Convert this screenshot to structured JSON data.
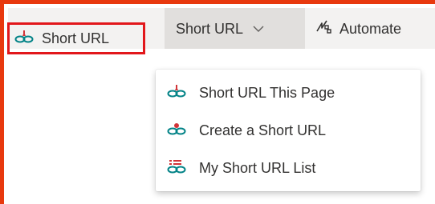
{
  "toolbar": {
    "short_url_button": {
      "label": "Short URL",
      "icon": "link-icon"
    },
    "short_url_dropdown": {
      "label": "Short URL",
      "icon": "chevron-down-icon"
    },
    "automate_button": {
      "label": "Automate",
      "icon": "automate-icon"
    }
  },
  "menu": {
    "items": [
      {
        "label": "Short URL This Page",
        "icon": "link-icon"
      },
      {
        "label": "Create a Short URL",
        "icon": "link-icon"
      },
      {
        "label": "My Short URL List",
        "icon": "link-list-icon"
      }
    ]
  },
  "colors": {
    "frame_border": "#e8390e",
    "highlight_border": "#e2171b",
    "toolbar_bg": "#f3f2f1",
    "active_bg": "#e1dfdd",
    "icon_red": "#d13438",
    "icon_teal": "#038387",
    "text": "#323130"
  }
}
